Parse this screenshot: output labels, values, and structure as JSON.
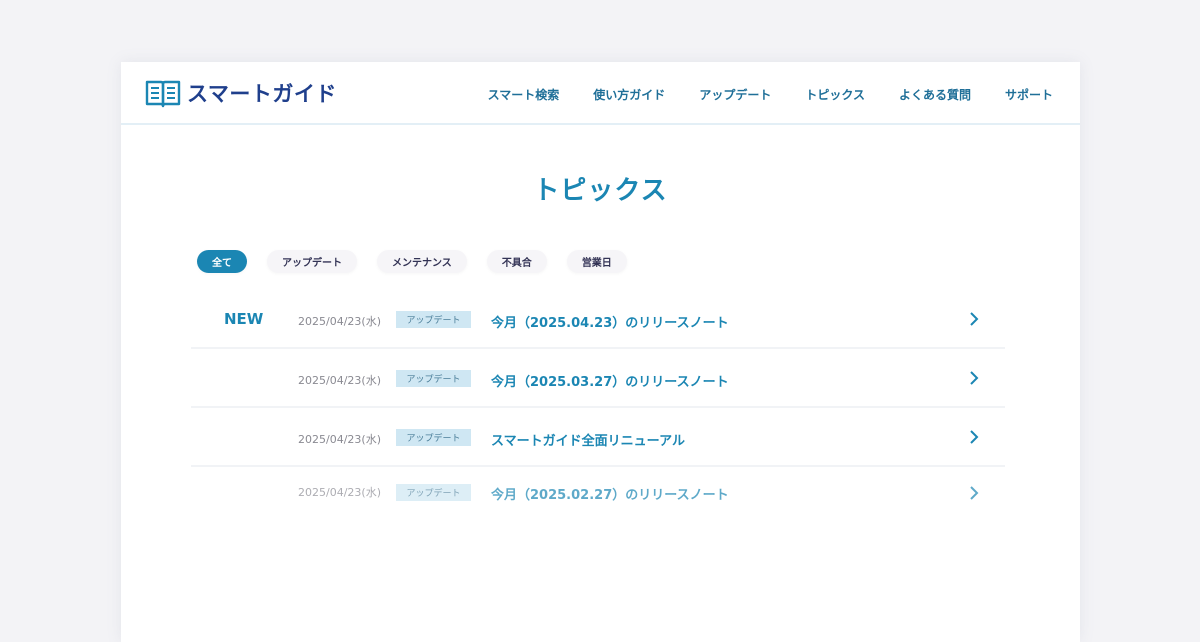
{
  "site": {
    "name": "スマートガイド"
  },
  "nav": [
    "スマート検索",
    "使い方ガイド",
    "アップデート",
    "トピックス",
    "よくある質問",
    "サポート"
  ],
  "page": {
    "title": "トピックス"
  },
  "filters": [
    {
      "label": "全て",
      "active": true
    },
    {
      "label": "アップデート",
      "active": false
    },
    {
      "label": "メンテナンス",
      "active": false
    },
    {
      "label": "不具合",
      "active": false
    },
    {
      "label": "営業日",
      "active": false
    }
  ],
  "topics": [
    {
      "badge": "NEW",
      "date": "2025/04/23(水)",
      "category": "アップデート",
      "title": "今月（2025.04.23）のリリースノート"
    },
    {
      "badge": "",
      "date": "2025/04/23(水)",
      "category": "アップデート",
      "title": "今月（2025.03.27）のリリースノート"
    },
    {
      "badge": "",
      "date": "2025/04/23(水)",
      "category": "アップデート",
      "title": "スマートガイド全面リニューアル"
    },
    {
      "badge": "",
      "date": "2025/04/23(水)",
      "category": "アップデート",
      "title": "今月（2025.02.27）のリリースノート"
    }
  ],
  "colors": {
    "accent": "#1b86b3",
    "brand": "#1f3f8c",
    "category_bg": "#cfe7f3"
  },
  "icons": {
    "logo": "open-book-icon",
    "row_arrow": "chevron-right-icon"
  }
}
